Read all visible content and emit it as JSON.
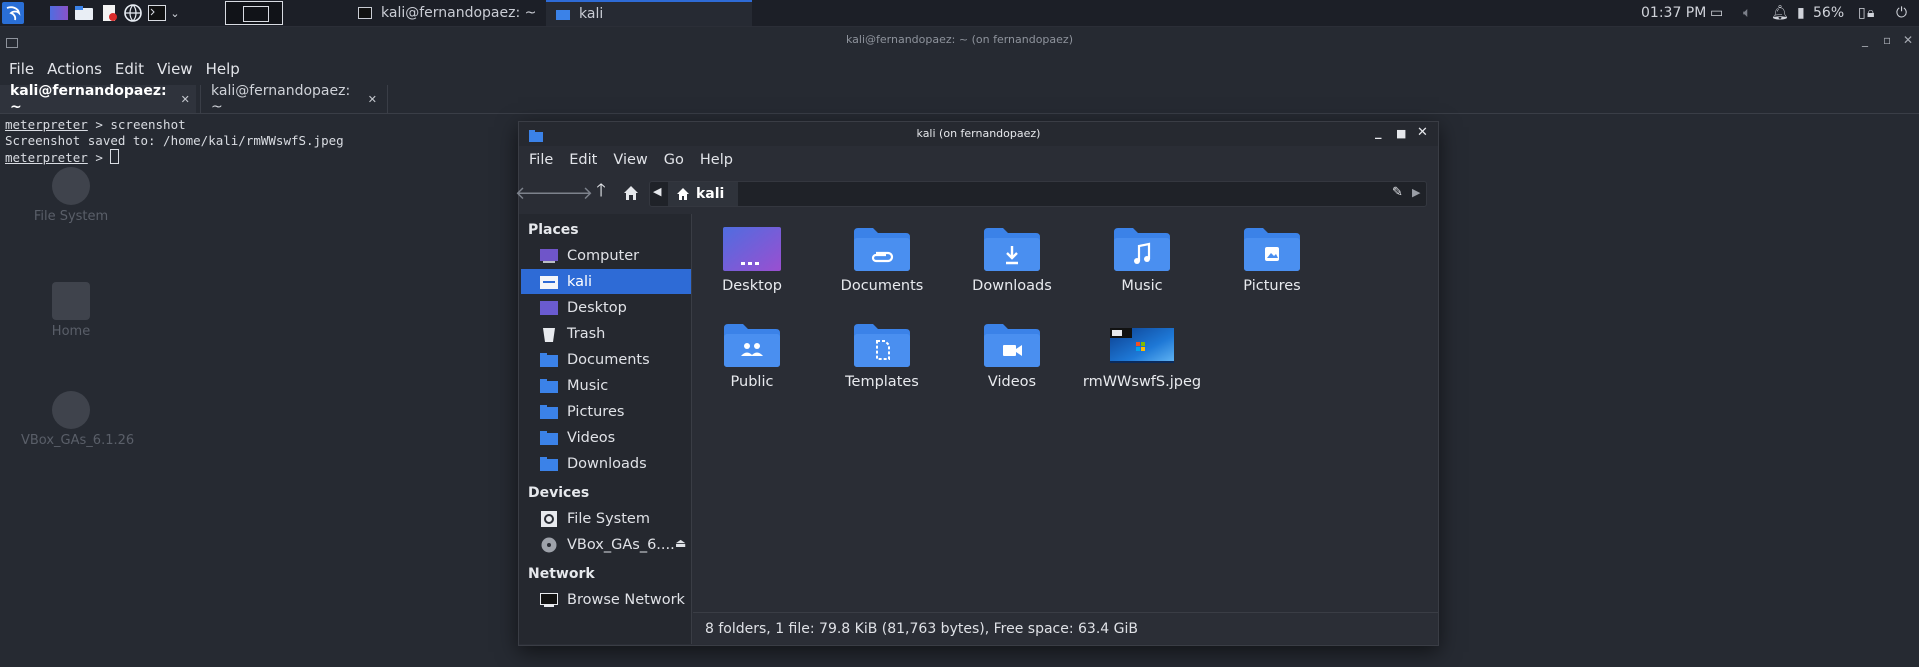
{
  "panel": {
    "tasks": [
      {
        "label": "kali@fernandopaez: ~"
      },
      {
        "label": "kali"
      }
    ],
    "clock": "01:37 PM",
    "battery": "56%"
  },
  "desktop": {
    "icons": [
      {
        "label": "File System"
      },
      {
        "label": "Home"
      },
      {
        "label": "VBox_GAs_6.1.26"
      }
    ]
  },
  "terminal": {
    "title": "kali@fernandopaez: ~ (on fernandopaez)",
    "menu": [
      "File",
      "Actions",
      "Edit",
      "View",
      "Help"
    ],
    "tabs": [
      {
        "label": "kali@fernandopaez: ~"
      },
      {
        "label": "kali@fernandopaez: ~"
      }
    ],
    "console": {
      "prompt": "meterpreter",
      "line1_cmd": " > screenshot",
      "line2": "Screenshot saved to: /home/kali/rmWWswfS.jpeg",
      "line3_cmd": " > "
    }
  },
  "filemanager": {
    "title": "kali (on fernandopaez)",
    "menu": [
      "File",
      "Edit",
      "View",
      "Go",
      "Help"
    ],
    "path": "kali",
    "sidebar": {
      "places_label": "Places",
      "places": [
        "Computer",
        "kali",
        "Desktop",
        "Trash",
        "Documents",
        "Music",
        "Pictures",
        "Videos",
        "Downloads"
      ],
      "devices_label": "Devices",
      "devices": [
        "File System",
        "VBox_GAs_6...."
      ],
      "network_label": "Network",
      "network": [
        "Browse Network"
      ]
    },
    "items": [
      "Desktop",
      "Documents",
      "Downloads",
      "Music",
      "Pictures",
      "Public",
      "Templates",
      "Videos",
      "rmWWswfS.jpeg"
    ],
    "status": "8 folders, 1 file: 79.8 KiB (81,763 bytes), Free space: 63.4 GiB"
  },
  "colors": {
    "accent": "#2e6bd6",
    "folder": "#3b82e8",
    "background": "#23262e"
  }
}
